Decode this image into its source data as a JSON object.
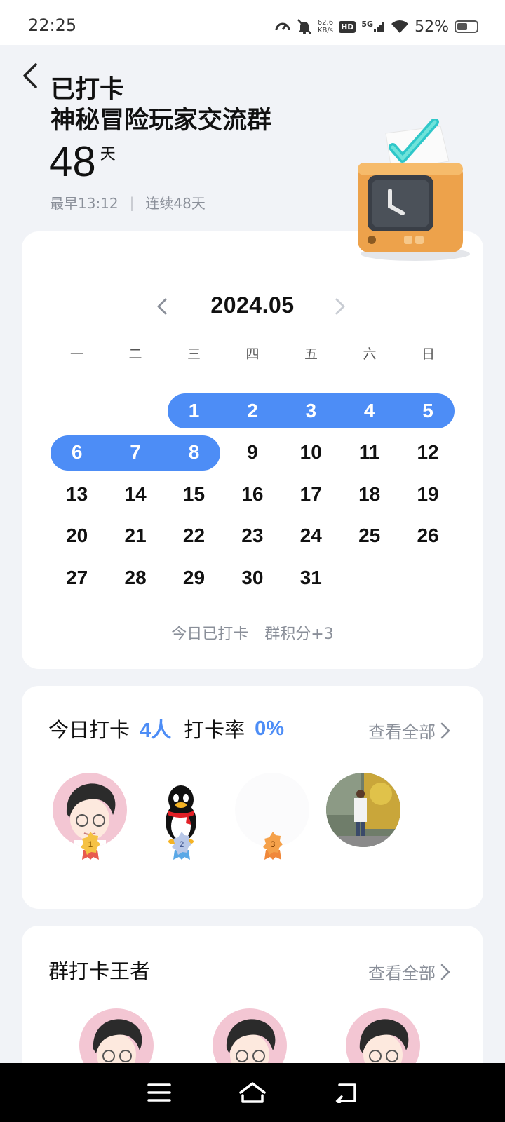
{
  "status_bar": {
    "time": "22:25",
    "net_speed_value": "62.6",
    "net_speed_unit": "KB/s",
    "hd": "HD",
    "signal": "5G",
    "battery": "52%",
    "battery_level": 0.52
  },
  "header": {
    "status": "已打卡",
    "group_name": "神秘冒险玩家交流群",
    "days": "48",
    "days_unit": "天",
    "earliest": "最早13:12",
    "streak": "连续48天"
  },
  "calendar": {
    "month": "2024.05",
    "weekdays": [
      "一",
      "二",
      "三",
      "四",
      "五",
      "六",
      "日"
    ],
    "weeks": [
      [
        "",
        "",
        "1",
        "2",
        "3",
        "4",
        "5"
      ],
      [
        "6",
        "7",
        "8",
        "9",
        "10",
        "11",
        "12"
      ],
      [
        "13",
        "14",
        "15",
        "16",
        "17",
        "18",
        "19"
      ],
      [
        "20",
        "21",
        "22",
        "23",
        "24",
        "25",
        "26"
      ],
      [
        "27",
        "28",
        "29",
        "30",
        "31",
        "",
        ""
      ]
    ],
    "checked_days": [
      1,
      2,
      3,
      4,
      5,
      6,
      7,
      8
    ],
    "footer_left": "今日已打卡",
    "footer_right": "群积分+3",
    "accent": "#4d8df6"
  },
  "today": {
    "label": "今日打卡",
    "count": "4人",
    "rate_label": "打卡率",
    "rate": "0%",
    "view_all": "查看全部",
    "avatars": [
      {
        "icon": "cartoon-boy-avatar",
        "rank": "1"
      },
      {
        "icon": "qq-penguin-avatar",
        "rank": "2"
      },
      {
        "icon": "blank-avatar",
        "rank": "3"
      },
      {
        "icon": "photo-avatar",
        "rank": ""
      }
    ]
  },
  "king": {
    "title": "群打卡王者",
    "view_all": "查看全部"
  }
}
